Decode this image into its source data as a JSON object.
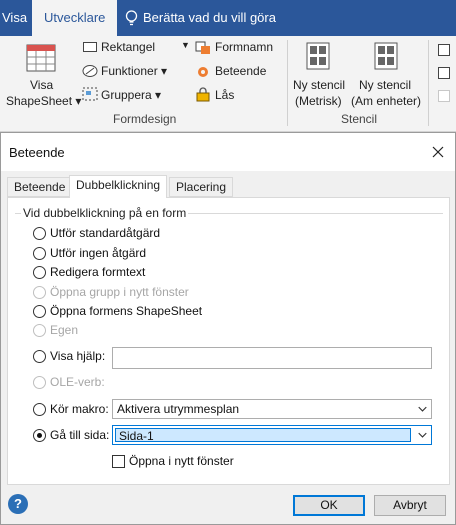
{
  "ribbon": {
    "tabs": [
      {
        "label": "Visa"
      },
      {
        "label": "Utvecklare"
      },
      {
        "label": "Berätta vad du vill göra"
      }
    ],
    "visa_shapesheet": {
      "line1": "Visa",
      "line2": "ShapeSheet"
    },
    "formdesign": {
      "rektangel": "Rektangel",
      "funktioner": "Funktioner",
      "gruppera": "Gruppera",
      "formnamn": "Formnamn",
      "beteende": "Beteende",
      "las": "Lås",
      "group_label": "Formdesign"
    },
    "stencil": {
      "ny_metrisk_1": "Ny stencil",
      "ny_metrisk_2": "(Metrisk)",
      "ny_am_1": "Ny stencil",
      "ny_am_2": "(Am enheter)",
      "group_label": "Stencil"
    }
  },
  "dialog": {
    "title": "Beteende",
    "tabs": [
      "Beteende",
      "Dubbelklickning",
      "Placering"
    ],
    "group_label": "Vid dubbelklickning på en form",
    "options": [
      {
        "label": "Utför standardåtgärd",
        "enabled": true
      },
      {
        "label": "Utför ingen åtgärd",
        "enabled": true
      },
      {
        "label": "Redigera formtext",
        "enabled": true
      },
      {
        "label": "Öppna grupp i nytt fönster",
        "enabled": false
      },
      {
        "label": "Öppna formens ShapeSheet",
        "enabled": true
      },
      {
        "label": "Egen",
        "enabled": false
      },
      {
        "label": "Visa hjälp:",
        "enabled": true
      },
      {
        "label": "OLE-verb:",
        "enabled": false
      },
      {
        "label": "Kör makro:",
        "enabled": true
      },
      {
        "label": "Gå till sida:",
        "enabled": true,
        "checked": true
      }
    ],
    "visa_hjalp_value": "",
    "macro_value": "Aktivera utrymmesplan",
    "page_value": "Sida-1",
    "open_new_window_label": "Öppna i nytt fönster",
    "buttons": {
      "ok": "OK",
      "cancel": "Avbryt",
      "help": "?"
    }
  },
  "colors": {
    "ribbon_blue": "#2b579a",
    "accent": "#0078d7",
    "selection": "#cde8ff"
  }
}
